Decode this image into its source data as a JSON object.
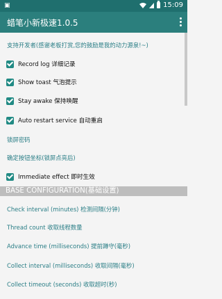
{
  "status": {
    "left_icon": "notification-icon",
    "time": "15:09"
  },
  "app": {
    "title": "蜡笔小新极速1.0.5"
  },
  "support_link": "支持开发者(感谢老板打赏,您的鼓励是我的动力源泉!~)",
  "options": [
    {
      "label": "Record log 详细记录",
      "checked": true
    },
    {
      "label": "Show toast 气泡提示",
      "checked": true
    },
    {
      "label": "Stay awake 保持唤醒",
      "checked": true
    },
    {
      "label": "Auto restart service 自动重启",
      "checked": true
    }
  ],
  "links": {
    "lock_password": "锁屏密码",
    "confirm_button_coords": "确定按钮坐标(锁屏点亮后)"
  },
  "immediate": {
    "label": "Immediate effect 即时生效",
    "checked": true
  },
  "section_header": "BASE CONFIGURATION(基础设置)",
  "settings": [
    "Check interval (minutes) 检测间隔(分钟)",
    "Thread count 收取线程数量",
    "Advance time (milliseconds) 提前蹲守(毫秒)",
    "Collect interval (milliseconds) 收取间隔(毫秒)",
    "Collect timeout (seconds) 收取超时(秒)"
  ],
  "colors": {
    "appbar": "#2b7f7d",
    "statusbar": "#1f6f6e",
    "accent": "#218a84",
    "link": "#2a7e86",
    "section": "#bdbdbd"
  }
}
